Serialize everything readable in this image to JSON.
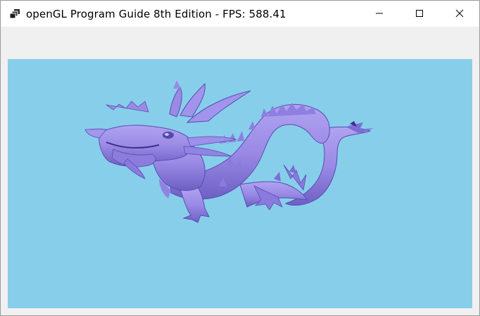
{
  "window": {
    "title": "openGL Program Guide 8th Edition - FPS: 588.41",
    "app_icon": "window-stack-icon"
  },
  "caption_buttons": {
    "minimize_icon": "minimize-icon",
    "maximize_icon": "maximize-icon",
    "close_icon": "close-icon"
  },
  "viewport": {
    "clear_color": "#87ceeb",
    "model": "dragon",
    "model_color": "#9a8ae6"
  }
}
